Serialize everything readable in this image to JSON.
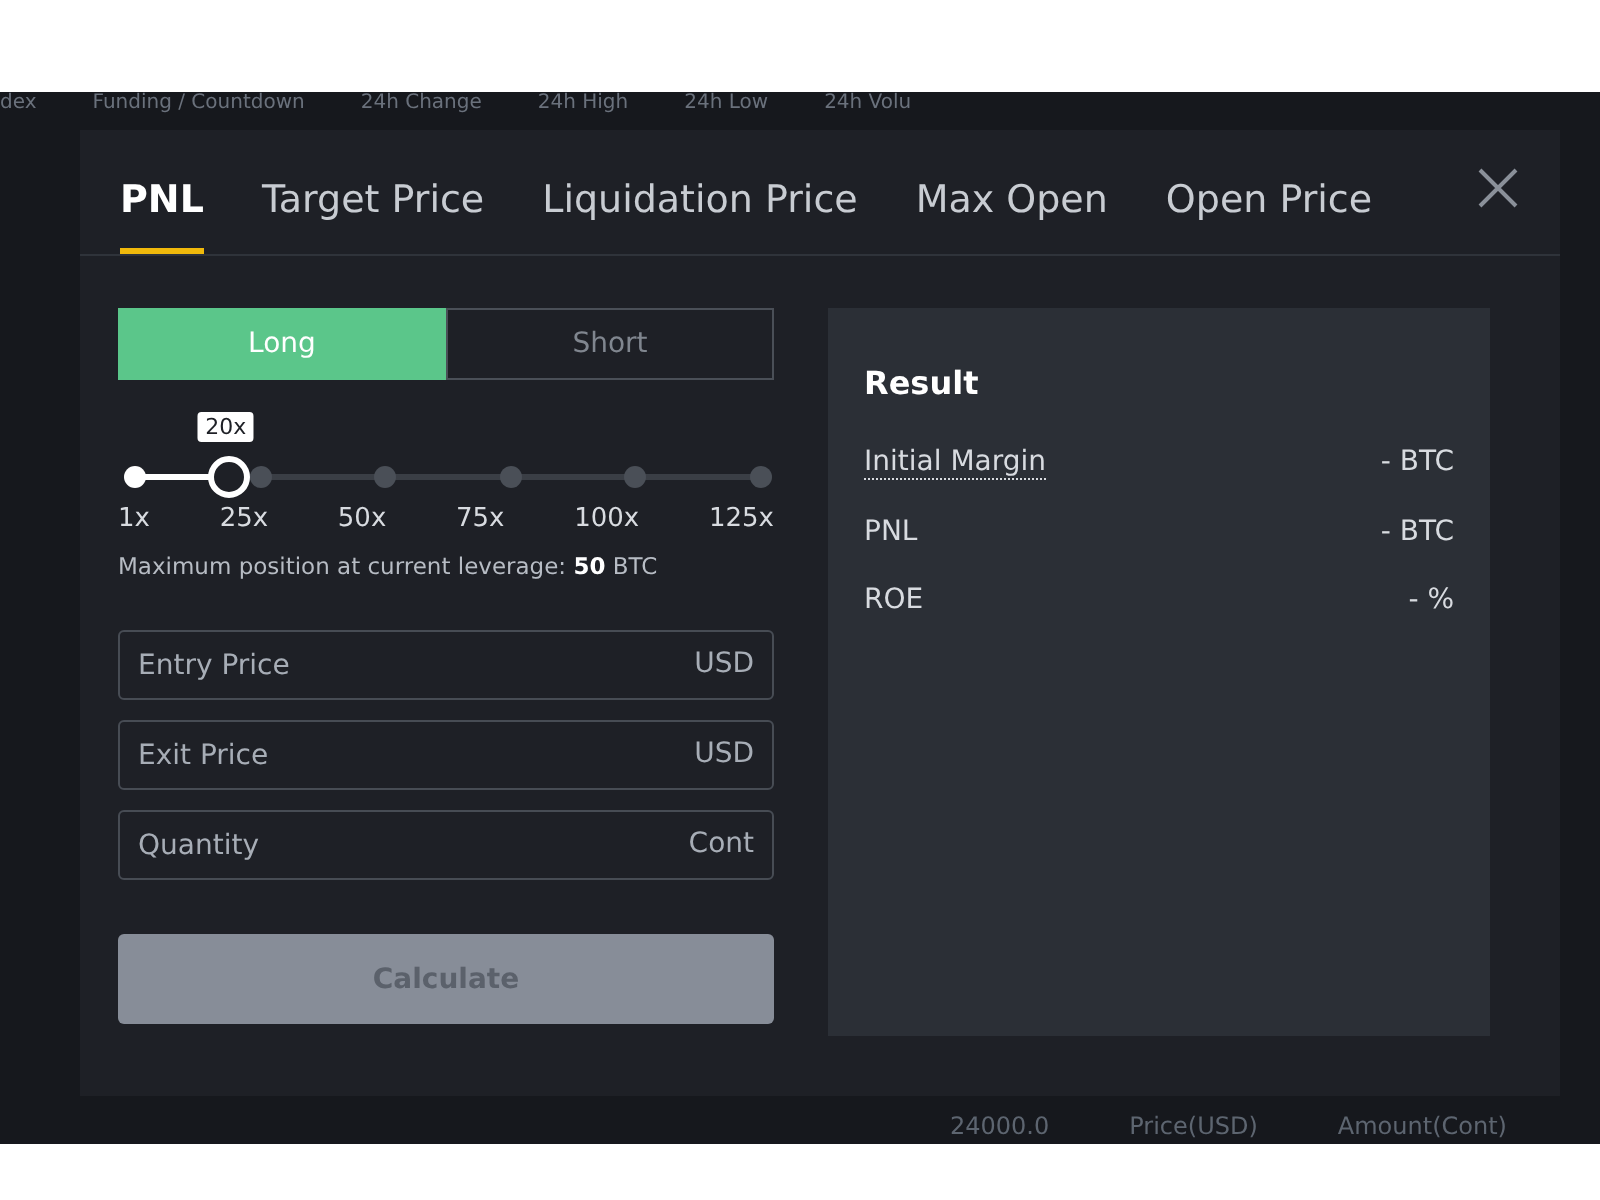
{
  "background": {
    "header_columns": [
      "dex",
      "Funding / Countdown",
      "24h Change",
      "24h High",
      "24h Low",
      "24h Volu"
    ],
    "footer_columns": [
      "24000.0",
      "Price(USD)",
      "Amount(Cont)"
    ]
  },
  "modal": {
    "tabs": [
      {
        "label": "PNL",
        "selected": true
      },
      {
        "label": "Target Price",
        "selected": false
      },
      {
        "label": "Liquidation Price",
        "selected": false
      },
      {
        "label": "Max Open",
        "selected": false
      },
      {
        "label": "Open Price",
        "selected": false
      }
    ],
    "sides": [
      {
        "label": "Long",
        "selected": true
      },
      {
        "label": "Short",
        "selected": false
      }
    ],
    "leverage": {
      "value_label": "20x",
      "level": 0.15,
      "marks": [
        "1x",
        "25x",
        "50x",
        "75x",
        "100x",
        "125x"
      ]
    },
    "max_position": "Maximum position at current leverage: **50** BTC",
    "fields": [
      {
        "placeholder": "Entry Price",
        "unit": "USD"
      },
      {
        "placeholder": "Exit Price",
        "unit": "USD"
      },
      {
        "placeholder": "Quantity",
        "unit": "Cont"
      }
    ],
    "calculate": {
      "label": "Calculate",
      "disabled": true
    },
    "result": {
      "title": "Result",
      "rows": [
        {
          "label": "Initial Margin",
          "value": "- BTC",
          "underlined": true
        },
        {
          "label": "PNL",
          "value": "- BTC",
          "underlined": false
        },
        {
          "label": "ROE",
          "value": "- %",
          "underlined": false
        }
      ]
    }
  }
}
